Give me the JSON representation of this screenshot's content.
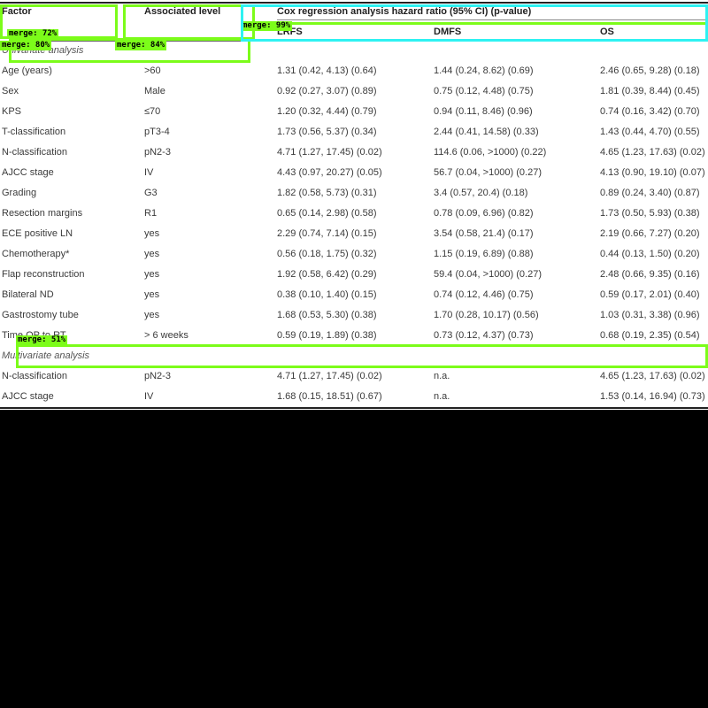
{
  "table": {
    "headers": {
      "factor": "Factor",
      "level": "Associated level",
      "group": "Cox regression analysis hazard ratio (95% CI) (p-value)",
      "lrfs": "LRFS",
      "dmfs": "DMFS",
      "os": "OS"
    },
    "section_univariate": "Univariate analysis",
    "section_multivariate": "Multivariate analysis",
    "rows": [
      {
        "factor": "Age (years)",
        "level": ">60",
        "lrfs": "1.31 (0.42, 4.13) (0.64)",
        "dmfs": "1.44 (0.24, 8.62) (0.69)",
        "os": "2.46 (0.65, 9.28) (0.18)"
      },
      {
        "factor": "Sex",
        "level": "Male",
        "lrfs": "0.92 (0.27, 3.07) (0.89)",
        "dmfs": "0.75 (0.12, 4.48) (0.75)",
        "os": "1.81 (0.39, 8.44) (0.45)"
      },
      {
        "factor": "KPS",
        "level": "≤70",
        "lrfs": "1.20 (0.32, 4.44) (0.79)",
        "dmfs": "0.94 (0.11, 8.46) (0.96)",
        "os": "0.74 (0.16, 3.42) (0.70)"
      },
      {
        "factor": "T-classification",
        "level": "pT3-4",
        "lrfs": "1.73 (0.56, 5.37) (0.34)",
        "dmfs": "2.44 (0.41, 14.58) (0.33)",
        "os": "1.43 (0.44, 4.70) (0.55)"
      },
      {
        "factor": "N-classification",
        "level": "pN2-3",
        "lrfs": "4.71 (1.27, 17.45) (0.02)",
        "dmfs": "114.6 (0.06, >1000) (0.22)",
        "os": "4.65 (1.23, 17.63) (0.02)"
      },
      {
        "factor": "AJCC stage",
        "level": "IV",
        "lrfs": "4.43 (0.97, 20.27) (0.05)",
        "dmfs": "56.7 (0.04, >1000) (0.27)",
        "os": "4.13 (0.90, 19.10) (0.07)"
      },
      {
        "factor": "Grading",
        "level": "G3",
        "lrfs": "1.82 (0.58, 5.73) (0.31)",
        "dmfs": "3.4 (0.57, 20.4) (0.18)",
        "os": "0.89 (0.24, 3.40) (0.87)"
      },
      {
        "factor": "Resection margins",
        "level": "R1",
        "lrfs": "0.65 (0.14, 2.98) (0.58)",
        "dmfs": "0.78 (0.09, 6.96) (0.82)",
        "os": "1.73 (0.50, 5.93) (0.38)"
      },
      {
        "factor": "ECE positive LN",
        "level": "yes",
        "lrfs": "2.29 (0.74, 7.14) (0.15)",
        "dmfs": "3.54 (0.58, 21.4) (0.17)",
        "os": "2.19 (0.66, 7.27) (0.20)"
      },
      {
        "factor": "Chemotherapy*",
        "level": "yes",
        "lrfs": "0.56 (0.18, 1.75) (0.32)",
        "dmfs": "1.15 (0.19, 6.89) (0.88)",
        "os": "0.44 (0.13, 1.50) (0.20)"
      },
      {
        "factor": "Flap reconstruction",
        "level": "yes",
        "lrfs": "1.92 (0.58, 6.42) (0.29)",
        "dmfs": "59.4 (0.04, >1000) (0.27)",
        "os": "2.48 (0.66, 9.35) (0.16)"
      },
      {
        "factor": "Bilateral ND",
        "level": "yes",
        "lrfs": "0.38 (0.10, 1.40) (0.15)",
        "dmfs": "0.74 (0.12, 4.46) (0.75)",
        "os": "0.59 (0.17, 2.01) (0.40)"
      },
      {
        "factor": "Gastrostomy tube",
        "level": "yes",
        "lrfs": "1.68 (0.53, 5.30) (0.38)",
        "dmfs": "1.70 (0.28, 10.17) (0.56)",
        "os": "1.03 (0.31, 3.38) (0.96)"
      },
      {
        "factor": "Time OP to RT",
        "level": "> 6 weeks",
        "lrfs": "0.59 (0.19, 1.89) (0.38)",
        "dmfs": "0.73 (0.12, 4.37) (0.73)",
        "os": "0.68 (0.19, 2.35) (0.54)"
      }
    ],
    "multi_rows": [
      {
        "factor": "N-classification",
        "level": "pN2-3",
        "lrfs": "4.71 (1.27, 17.45) (0.02)",
        "dmfs": "n.a.",
        "os": "4.65 (1.23, 17.63) (0.02)"
      },
      {
        "factor": "AJCC stage",
        "level": "IV",
        "lrfs": "1.68 (0.15, 18.51) (0.67)",
        "dmfs": "n.a.",
        "os": "1.53 (0.14, 16.94) (0.73)"
      }
    ]
  },
  "overlays": [
    {
      "label": "merge: 72%",
      "color": "#7cfc1a"
    },
    {
      "label": "merge: 80%",
      "color": "#7cfc1a"
    },
    {
      "label": "merge: 84%",
      "color": "#7cfc1a"
    },
    {
      "label": "merge: 99%",
      "color": "#7cfc1a"
    },
    {
      "label": "",
      "color": "#2ef2f2"
    },
    {
      "label": "merge: 51%",
      "color": "#7cfc1a"
    }
  ]
}
